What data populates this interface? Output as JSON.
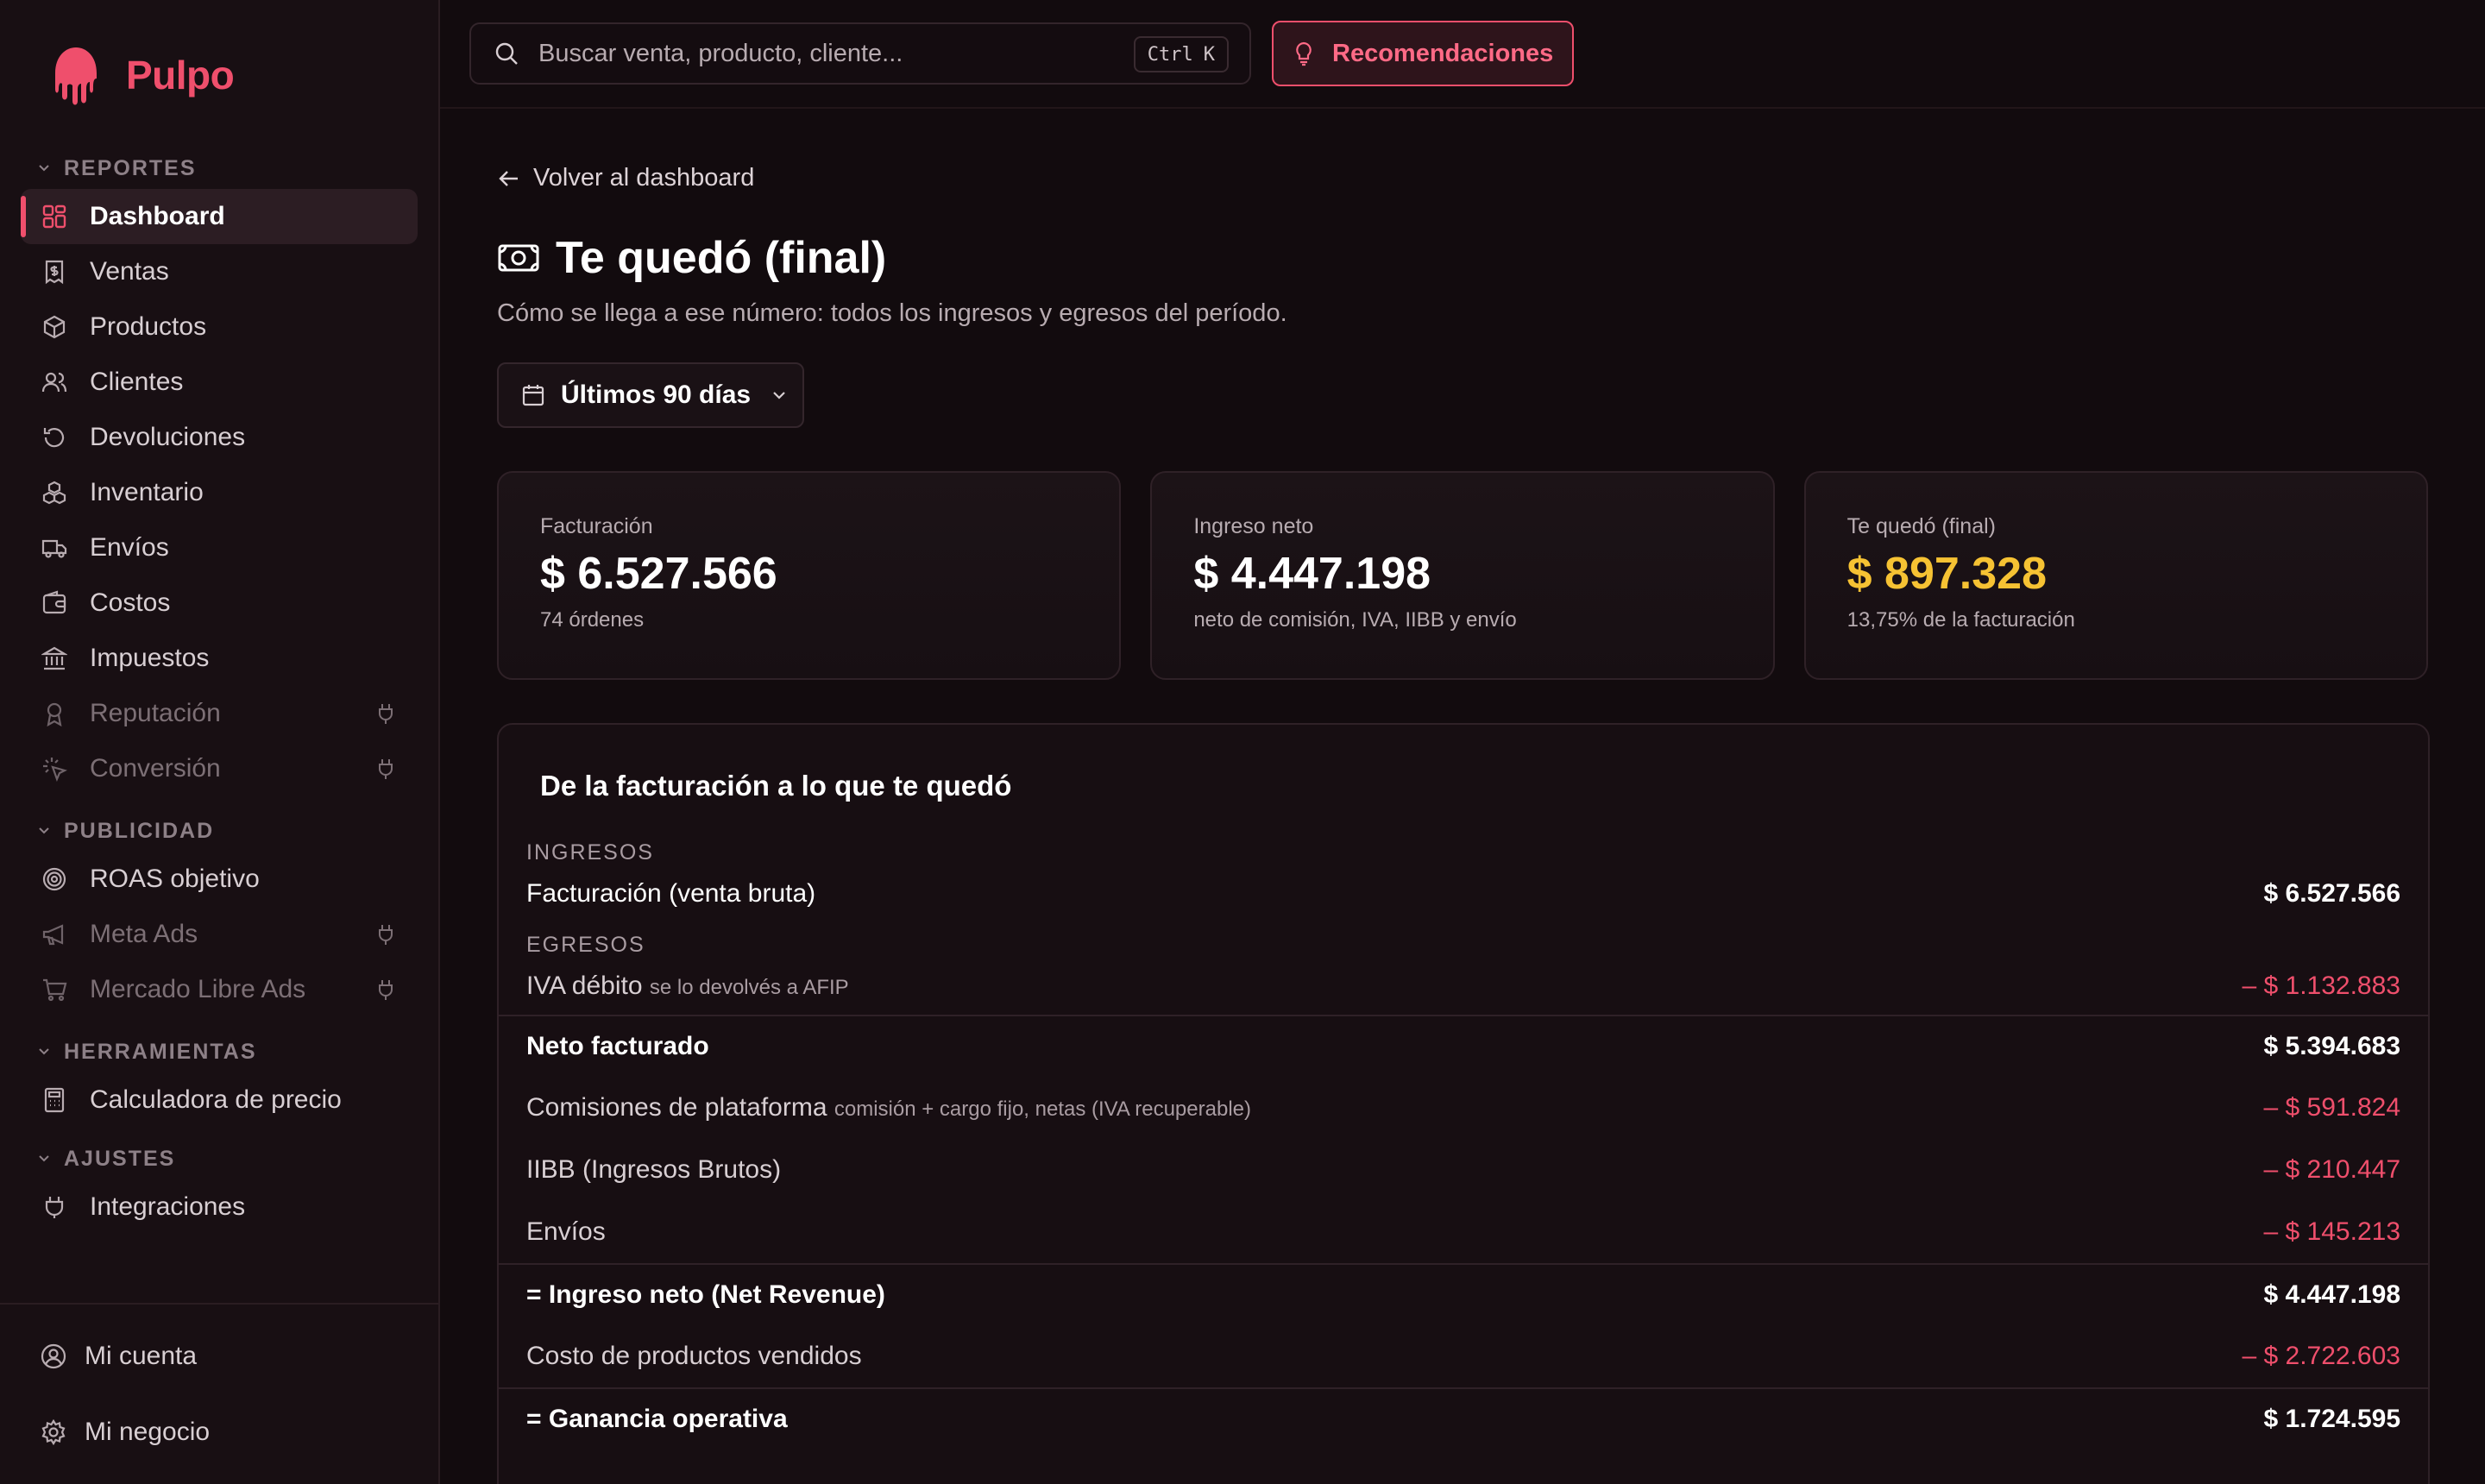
{
  "app": {
    "name": "Pulpo",
    "brand_color": "#ef4f6c"
  },
  "sidebar": {
    "sections": [
      {
        "title": "REPORTES",
        "items": [
          {
            "label": "Dashboard",
            "icon": "grid-icon",
            "active": true
          },
          {
            "label": "Ventas",
            "icon": "receipt-icon"
          },
          {
            "label": "Productos",
            "icon": "box-icon"
          },
          {
            "label": "Clientes",
            "icon": "users-icon"
          },
          {
            "label": "Devoluciones",
            "icon": "undo-icon"
          },
          {
            "label": "Inventario",
            "icon": "boxes-icon"
          },
          {
            "label": "Envíos",
            "icon": "truck-icon"
          },
          {
            "label": "Costos",
            "icon": "wallet-icon"
          },
          {
            "label": "Impuestos",
            "icon": "bank-icon"
          },
          {
            "label": "Reputación",
            "icon": "award-icon",
            "disabled": true
          },
          {
            "label": "Conversión",
            "icon": "sparkle-icon",
            "disabled": true
          }
        ]
      },
      {
        "title": "PUBLICIDAD",
        "items": [
          {
            "label": "ROAS objetivo",
            "icon": "target-icon"
          },
          {
            "label": "Meta Ads",
            "icon": "megaphone-icon",
            "disabled": true
          },
          {
            "label": "Mercado Libre Ads",
            "icon": "cart-icon",
            "disabled": true
          }
        ]
      },
      {
        "title": "HERRAMIENTAS",
        "items": [
          {
            "label": "Calculadora de precio",
            "icon": "calculator-icon"
          }
        ]
      },
      {
        "title": "AJUSTES",
        "items": [
          {
            "label": "Integraciones",
            "icon": "plug-icon"
          }
        ]
      }
    ],
    "bottom": [
      {
        "label": "Mi cuenta",
        "icon": "user-circle-icon"
      },
      {
        "label": "Mi negocio",
        "icon": "gear-icon"
      }
    ]
  },
  "topbar": {
    "search_placeholder": "Buscar venta, producto, cliente...",
    "shortcut_ctrl": "Ctrl",
    "shortcut_key": "K",
    "recommendations_label": "Recomendaciones"
  },
  "page": {
    "back_label": "Volver al dashboard",
    "title": "Te quedó (final)",
    "subtitle": "Cómo se llega a ese número: todos los ingresos y egresos del período.",
    "range_label": "Últimos 90 días"
  },
  "cards": [
    {
      "label": "Facturación",
      "value": "$ 6.527.566",
      "note": "74 órdenes",
      "highlight": false
    },
    {
      "label": "Ingreso neto",
      "value": "$ 4.447.198",
      "note": "neto de comisión, IVA, IIBB y envío",
      "highlight": false
    },
    {
      "label": "Te quedó (final)",
      "value": "$ 897.328",
      "note": "13,75% de la facturación",
      "highlight": true
    }
  ],
  "breakdown": {
    "title": "De la facturación a lo que te quedó",
    "ingresos_label": "INGRESOS",
    "egresos_label": "EGRESOS",
    "rows": {
      "facturacion": {
        "label": "Facturación (venta bruta)",
        "value": "$ 6.527.566"
      },
      "iva": {
        "label": "IVA débito",
        "hint": "se lo devolvés a AFIP",
        "value": "– $ 1.132.883"
      },
      "neto_facturado": {
        "label": "Neto facturado",
        "value": "$ 5.394.683"
      },
      "comisiones": {
        "label": "Comisiones de plataforma",
        "hint": "comisión + cargo fijo, netas (IVA recuperable)",
        "value": "– $ 591.824"
      },
      "iibb": {
        "label": "IIBB (Ingresos Brutos)",
        "value": "– $ 210.447"
      },
      "envios": {
        "label": "Envíos",
        "value": "– $ 145.213"
      },
      "ingreso_neto": {
        "label": "= Ingreso neto (Net Revenue)",
        "value": "$ 4.447.198"
      },
      "costo_productos": {
        "label": "Costo de productos vendidos",
        "value": "– $ 2.722.603"
      },
      "ganancia_operativa": {
        "label": "= Ganancia operativa",
        "value": "$ 1.724.595"
      }
    }
  },
  "colors": {
    "negative": "#ef4f6c",
    "highlight": "#f6c233"
  }
}
